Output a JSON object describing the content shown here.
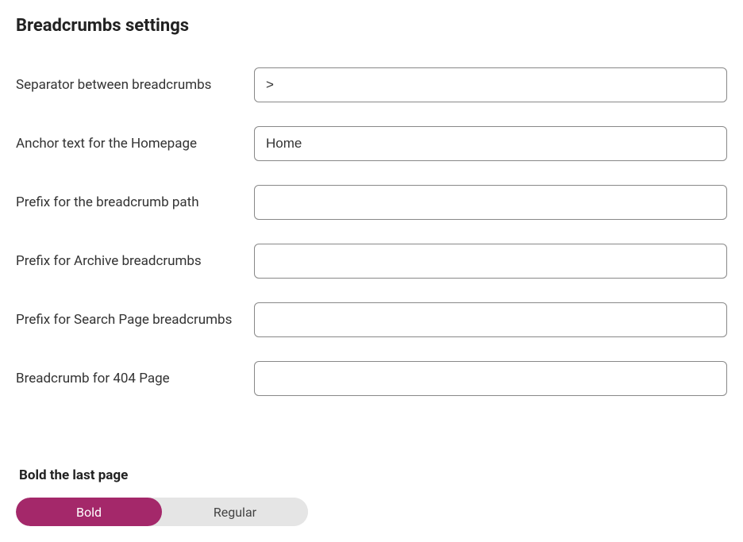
{
  "title": "Breadcrumbs settings",
  "fields": {
    "separator": {
      "label": "Separator between breadcrumbs",
      "value": ">"
    },
    "anchor_home": {
      "label": "Anchor text for the Homepage",
      "value": "Home"
    },
    "prefix_path": {
      "label": "Prefix for the breadcrumb path",
      "value": ""
    },
    "prefix_archive": {
      "label": "Prefix for Archive breadcrumbs",
      "value": ""
    },
    "prefix_search": {
      "label": "Prefix for Search Page breadcrumbs",
      "value": ""
    },
    "breadcrumb_404": {
      "label": "Breadcrumb for 404 Page",
      "value": ""
    }
  },
  "bold_toggle": {
    "label": "Bold the last page",
    "option_active": "Bold",
    "option_inactive": "Regular"
  }
}
